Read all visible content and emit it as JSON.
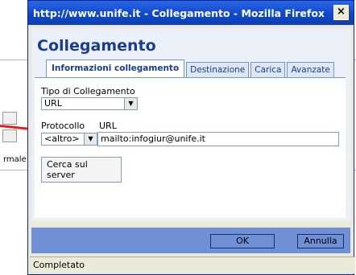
{
  "background": {
    "snippet_text": "rmale"
  },
  "window": {
    "title": "http://www.unife.it - Collegamento - Mozilla Firefox",
    "close_label": "×"
  },
  "dialog": {
    "heading": "Collegamento",
    "tabs": [
      {
        "label": "Informazioni collegamento",
        "active": true
      },
      {
        "label": "Destinazione",
        "active": false
      },
      {
        "label": "Carica",
        "active": false
      },
      {
        "label": "Avanzate",
        "active": false
      }
    ],
    "link_type": {
      "label": "Tipo di Collegamento",
      "value": "URL"
    },
    "protocol": {
      "label": "Protocollo",
      "value": "<altro>"
    },
    "url": {
      "label": "URL",
      "value": "mailto:infogiur@unife.it"
    },
    "browse_server_label": "Cerca sul server",
    "ok_label": "OK",
    "cancel_label": "Annulla"
  },
  "status_bar": {
    "text": "Completato"
  },
  "colors": {
    "accent": "#1a3f8a",
    "footer": "#6f8fd6",
    "arrow": "#e02020"
  }
}
